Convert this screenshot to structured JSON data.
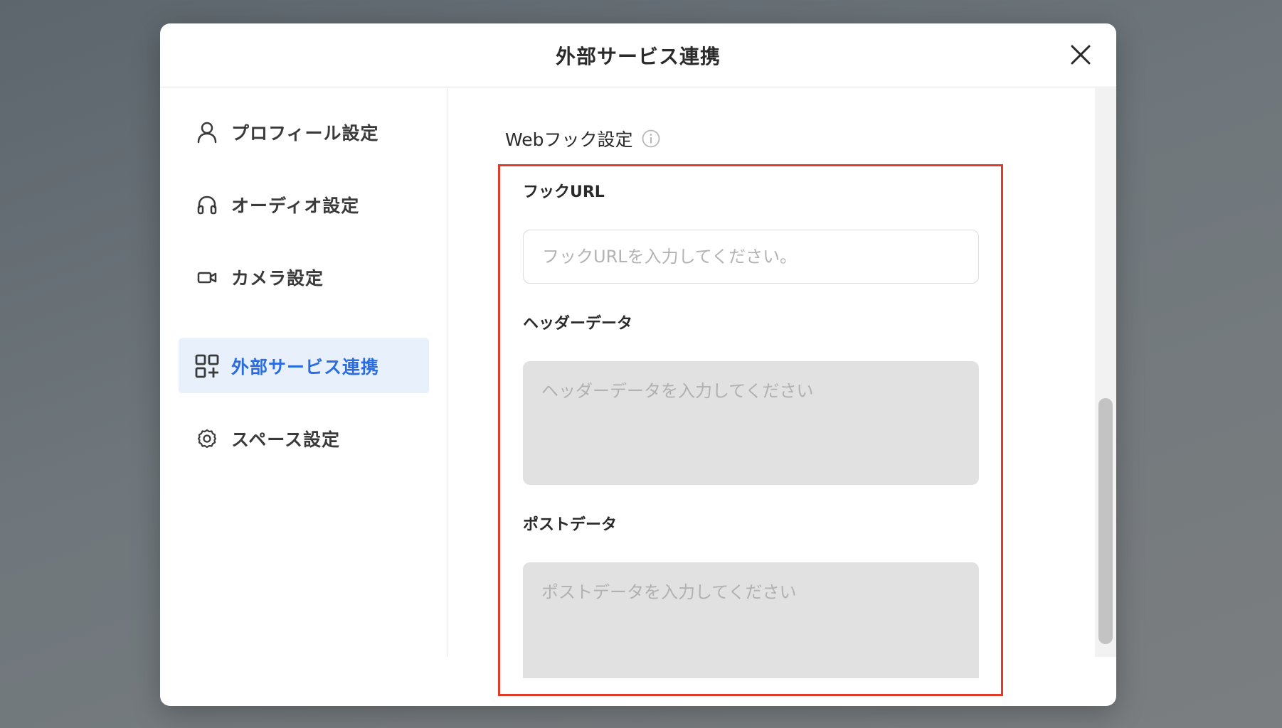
{
  "modal": {
    "title": "外部サービス連携"
  },
  "sidebar": {
    "items": [
      {
        "label": "プロフィール設定",
        "icon": "user-icon",
        "active": false
      },
      {
        "label": "オーディオ設定",
        "icon": "headphones-icon",
        "active": false
      },
      {
        "label": "カメラ設定",
        "icon": "video-camera-icon",
        "active": false
      },
      {
        "label": "外部サービス連携",
        "icon": "apps-add-icon",
        "active": true
      },
      {
        "label": "スペース設定",
        "icon": "gear-icon",
        "active": false
      }
    ]
  },
  "content": {
    "section_title": "Webフック設定",
    "hook_url": {
      "label": "フックURL",
      "placeholder": "フックURLを入力してください。",
      "value": ""
    },
    "header_data": {
      "label": "ヘッダーデータ",
      "placeholder": "ヘッダーデータを入力してください",
      "value": ""
    },
    "post_data": {
      "label": "ポストデータ",
      "placeholder": "ポストデータを入力してください",
      "value": ""
    }
  },
  "colors": {
    "accent": "#2b6de0",
    "active_bg": "#e8f0fc",
    "highlight_border": "#e03a2a",
    "textarea_bg": "#e1e1e1"
  }
}
